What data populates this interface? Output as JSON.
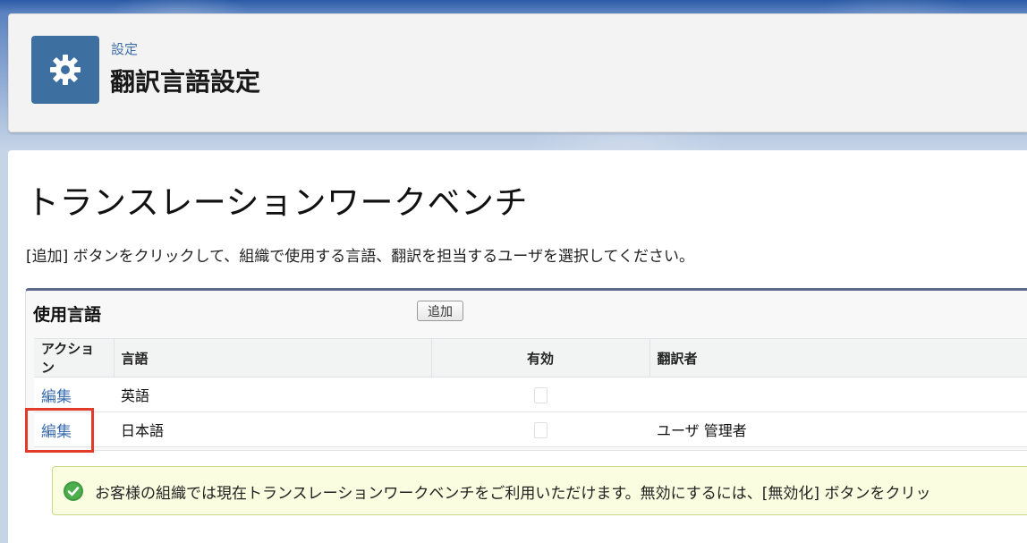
{
  "header": {
    "breadcrumb": "設定",
    "title": "翻訳言語設定",
    "icon": "gear-icon",
    "icon_color": "#3d6fa1"
  },
  "main": {
    "heading": "トランスレーションワークベンチ",
    "instruction": "[追加] ボタンをクリックして、組織で使用する言語、翻訳を担当するユーザを選択してください。",
    "languages_list": {
      "title": "使用言語",
      "add_button_label": "追加",
      "columns": [
        "アクション",
        "言語",
        "有効",
        "翻訳者"
      ],
      "rows": [
        {
          "action": "編集",
          "language": "英語",
          "active": false,
          "translator": ""
        },
        {
          "action": "編集",
          "language": "日本語",
          "active": false,
          "translator": "ユーザ 管理者"
        }
      ]
    },
    "info_banner": {
      "icon": "check-circle-icon",
      "text": "お客様の組織では現在トランスレーションワークベンチをご利用いただけます。無効にするには、[無効化] ボタンをクリッ"
    }
  },
  "colors": {
    "link": "#3a6cb0",
    "highlight": "#e23b2a",
    "banner_bg": "#fbfde0"
  }
}
